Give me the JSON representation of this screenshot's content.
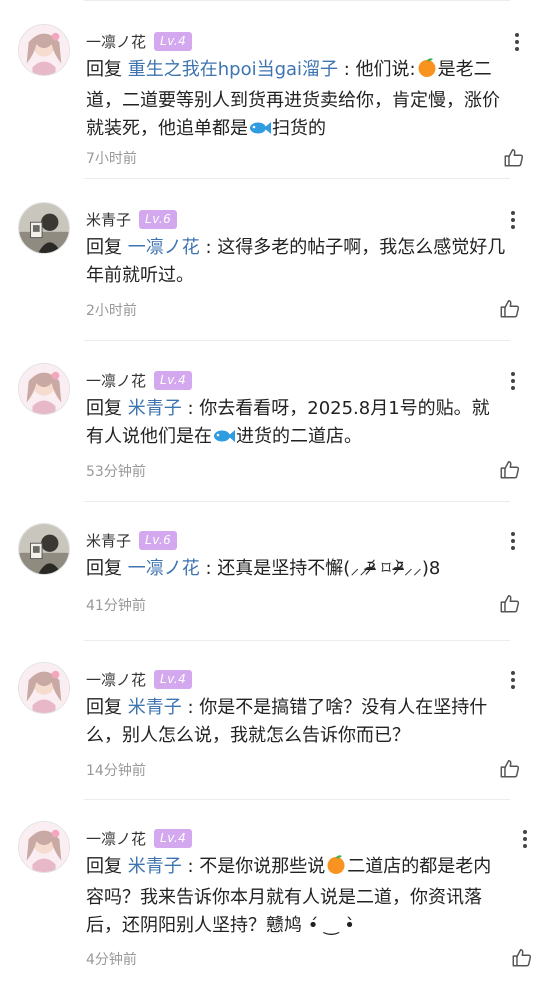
{
  "reply_label": "回复",
  "comments": [
    {
      "user": "一凛ノ花",
      "level": "Lv.4",
      "reply_to": "重生之我在hpoi当gai溜子",
      "segments": [
        "他们说:",
        "是老二道，二道要等别人到货再进货卖给你，肯定慢，涨价就装死，他追单都是",
        "扫货的"
      ],
      "time": "7小时前"
    },
    {
      "user": "米青子",
      "level": "Lv.6",
      "reply_to": "一凛ノ花",
      "segments": [
        "这得多老的帖子啊，我怎么感觉好几年前就听过。"
      ],
      "time": "2小时前"
    },
    {
      "user": "一凛ノ花",
      "level": "Lv.4",
      "reply_to": "米青子",
      "segments": [
        "你去看看呀，2025.8月1号的贴。就有人说他们是在",
        "进货的二道店。"
      ],
      "time": "53分钟前"
    },
    {
      "user": "米青子",
      "level": "Lv.6",
      "reply_to": "一凛ノ花",
      "segments": [
        "还真是坚持不懈(⸝⸝ᵒ̴̶̷᷄ ⌑ ᵒ̴̶̷᷅⸝⸝)8"
      ],
      "time": "41分钟前"
    },
    {
      "user": "一凛ノ花",
      "level": "Lv.4",
      "reply_to": "米青子",
      "segments": [
        "你是不是搞错了啥？没有人在坚持什么，别人怎么说，我就怎么告诉你而已？"
      ],
      "time": "14分钟前"
    },
    {
      "user": "一凛ノ花",
      "level": "Lv.4",
      "reply_to": "米青子",
      "segments": [
        "不是你说那些说",
        "二道店的都是老内容吗？我来告诉你本月就有人说是二道，你资讯落后，还阴阳别人坚持？戆鸠 •́ ‿ •̀"
      ],
      "time": "4分钟前"
    }
  ]
}
